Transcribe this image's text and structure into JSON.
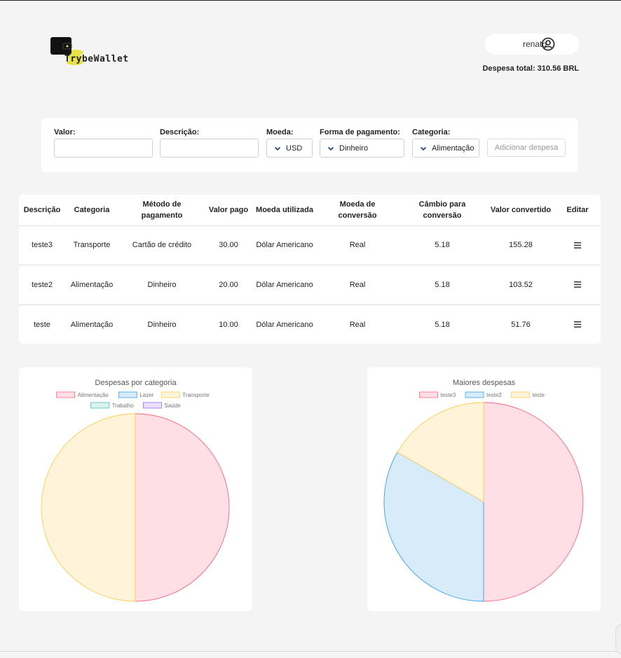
{
  "header": {
    "logo_text": "TrybeWallet",
    "user_name": "renato",
    "total_label": "Despesa total: 310.56 BRL"
  },
  "form": {
    "valor_label": "Valor:",
    "descricao_label": "Descrição:",
    "moeda_label": "Moeda:",
    "moeda_value": "USD",
    "pagamento_label": "Forma de pagamento:",
    "pagamento_value": "Dinheiro",
    "categoria_label": "Categoria:",
    "categoria_value": "Alimentação",
    "add_button": "Adicionar despesa"
  },
  "table": {
    "headers": [
      "Descrição",
      "Categoria",
      "Método de pagamento",
      "Valor pago",
      "Moeda utilizada",
      "Moeda de conversão",
      "Câmbio para conversão",
      "Valor convertido",
      "Editar"
    ],
    "rows": [
      [
        "teste3",
        "Transporte",
        "Cartão de crédito",
        "30.00",
        "Dólar Americano",
        "Real",
        "5.18",
        "155.28"
      ],
      [
        "teste2",
        "Alimentação",
        "Dinheiro",
        "20.00",
        "Dólar Americano",
        "Real",
        "5.18",
        "103.52"
      ],
      [
        "teste",
        "Alimentação",
        "Dinheiro",
        "10.00",
        "Dólar Americano",
        "Real",
        "5.18",
        "51.76"
      ]
    ]
  },
  "colors": {
    "pink_fill": "#ffdfe6",
    "pink_stroke": "#ff6384",
    "blue_fill": "#d7ebf8",
    "blue_stroke": "#36a2eb",
    "yellow_fill": "#fff3da",
    "yellow_stroke": "#ffce56",
    "teal_fill": "#dbf2f2",
    "teal_stroke": "#4bc0c0",
    "purple_fill": "#ebe0ff",
    "purple_stroke": "#9966ff"
  },
  "chart_data": [
    {
      "type": "pie",
      "title": "Despesas por categoria",
      "categories": [
        "Alimentação",
        "Lazer",
        "Transporte",
        "Trabalho",
        "Saúde"
      ],
      "values": [
        155.28,
        0,
        155.28,
        0,
        0
      ],
      "legend": "top"
    },
    {
      "type": "pie",
      "title": "Maiores despesas",
      "categories": [
        "teste3",
        "teste2",
        "teste"
      ],
      "values": [
        155.28,
        103.52,
        51.76
      ],
      "legend": "top"
    }
  ]
}
